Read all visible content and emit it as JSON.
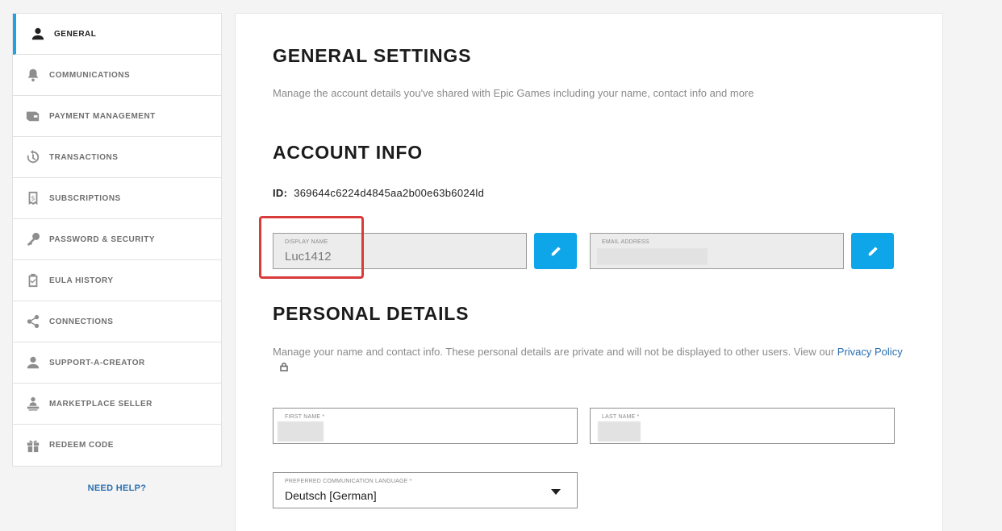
{
  "sidebar": {
    "items": [
      {
        "label": "GENERAL",
        "icon": "person-icon",
        "active": true
      },
      {
        "label": "COMMUNICATIONS",
        "icon": "bell-icon"
      },
      {
        "label": "PAYMENT MANAGEMENT",
        "icon": "wallet-icon"
      },
      {
        "label": "TRANSACTIONS",
        "icon": "history-icon"
      },
      {
        "label": "SUBSCRIPTIONS",
        "icon": "receipt-dollar-icon"
      },
      {
        "label": "PASSWORD & SECURITY",
        "icon": "key-icon"
      },
      {
        "label": "EULA HISTORY",
        "icon": "clipboard-check-icon"
      },
      {
        "label": "CONNECTIONS",
        "icon": "share-icon"
      },
      {
        "label": "SUPPORT-A-CREATOR",
        "icon": "person-icon"
      },
      {
        "label": "MARKETPLACE SELLER",
        "icon": "seller-desk-icon"
      },
      {
        "label": "REDEEM CODE",
        "icon": "gift-icon"
      }
    ],
    "help_label": "NEED HELP?"
  },
  "general": {
    "title": "GENERAL SETTINGS",
    "description": "Manage the account details you've shared with Epic Games including your name, contact info and more"
  },
  "account_info": {
    "title": "ACCOUNT INFO",
    "id_label": "ID:",
    "id_value": "369644c6224d4845aa2b00e63b6024ld",
    "display_name_label": "DISPLAY NAME",
    "display_name_value": "Luc1412",
    "email_label": "EMAIL ADDRESS",
    "email_value": ""
  },
  "personal_details": {
    "title": "PERSONAL DETAILS",
    "description": "Manage your name and contact info. These personal details are private and will not be displayed to other users. View our",
    "privacy_link": "Privacy Policy",
    "first_name_label": "FIRST NAME *",
    "last_name_label": "LAST NAME *",
    "language_label": "PREFERRED COMMUNICATION LANGUAGE *",
    "language_value": "Deutsch [German]"
  },
  "colors": {
    "accent": "#0ea5e9",
    "active_indicator": "#1fa3e6",
    "link": "#2a6fb0",
    "highlight_box": "#d93b3b"
  }
}
